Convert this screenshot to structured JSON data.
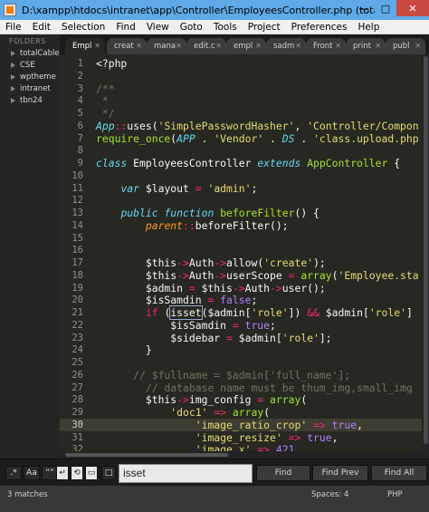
{
  "window": {
    "title": "D:\\xampp\\htdocs\\intranet\\app\\Controller\\EmployeesController.php (totalCable, C...",
    "controls": {
      "minimize": "—",
      "maximize": "□",
      "close": "✕"
    }
  },
  "menu": [
    "File",
    "Edit",
    "Selection",
    "Find",
    "View",
    "Goto",
    "Tools",
    "Project",
    "Preferences",
    "Help"
  ],
  "sidebar": {
    "header": "FOLDERS",
    "folders": [
      "totalCable",
      "CSE",
      "wptheme",
      "intranet",
      "tbn24"
    ]
  },
  "tabs": [
    {
      "label": "Empl",
      "active": true
    },
    {
      "label": "creat",
      "active": false
    },
    {
      "label": "mana",
      "active": false
    },
    {
      "label": "edit.c",
      "active": false
    },
    {
      "label": "empl",
      "active": false
    },
    {
      "label": "sadm",
      "active": false
    },
    {
      "label": "Front",
      "active": false
    },
    {
      "label": "print",
      "active": false
    },
    {
      "label": "publ",
      "active": false
    }
  ],
  "editor": {
    "current_line": 30,
    "line_numbers": [
      1,
      2,
      3,
      4,
      5,
      6,
      7,
      8,
      9,
      10,
      11,
      12,
      13,
      14,
      15,
      16,
      17,
      18,
      19,
      20,
      21,
      22,
      23,
      24,
      25,
      26,
      27,
      28,
      29,
      30,
      31,
      32
    ],
    "lines": [
      [
        [
          "wh",
          "<?php"
        ]
      ],
      [],
      [
        [
          "cm",
          "/**"
        ]
      ],
      [
        [
          "cm",
          " *"
        ]
      ],
      [
        [
          "cm",
          " */"
        ]
      ],
      [
        [
          "it",
          "App"
        ],
        [
          "kw",
          "::"
        ],
        [
          "wh",
          "uses("
        ],
        [
          "st",
          "'SimplePasswordHasher'"
        ],
        [
          "wh",
          ", "
        ],
        [
          "st",
          "'Controller/Compon"
        ]
      ],
      [
        [
          "fn",
          "require_once"
        ],
        [
          "wh",
          "("
        ],
        [
          "it",
          "APP"
        ],
        [
          "wh",
          " . "
        ],
        [
          "st",
          "'Vendor'"
        ],
        [
          "wh",
          " . "
        ],
        [
          "it",
          "DS"
        ],
        [
          "wh",
          " . "
        ],
        [
          "st",
          "'class.upload.php"
        ]
      ],
      [],
      [
        [
          "it",
          "class"
        ],
        [
          "wh",
          " EmployeesController "
        ],
        [
          "it",
          "extends"
        ],
        [
          "wh",
          " "
        ],
        [
          "fn",
          "AppController"
        ],
        [
          "wh",
          " {"
        ]
      ],
      [],
      [
        [
          "wh",
          "    "
        ],
        [
          "it",
          "var"
        ],
        [
          "wh",
          " $layout "
        ],
        [
          "kw",
          "="
        ],
        [
          "wh",
          " "
        ],
        [
          "st",
          "'admin'"
        ],
        [
          "wh",
          ";"
        ]
      ],
      [],
      [
        [
          "wh",
          "    "
        ],
        [
          "it",
          "public"
        ],
        [
          "wh",
          " "
        ],
        [
          "it",
          "function"
        ],
        [
          "wh",
          " "
        ],
        [
          "fn",
          "beforeFilter"
        ],
        [
          "wh",
          "() {"
        ]
      ],
      [
        [
          "wh",
          "        "
        ],
        [
          "va",
          "parent"
        ],
        [
          "kw",
          "::"
        ],
        [
          "wh",
          "beforeFilter();"
        ]
      ],
      [],
      [],
      [
        [
          "wh",
          "        $this"
        ],
        [
          "kw",
          "->"
        ],
        [
          "wh",
          "Auth"
        ],
        [
          "kw",
          "->"
        ],
        [
          "wh",
          "allow("
        ],
        [
          "st",
          "'create'"
        ],
        [
          "wh",
          ");"
        ]
      ],
      [
        [
          "wh",
          "        $this"
        ],
        [
          "kw",
          "->"
        ],
        [
          "wh",
          "Auth"
        ],
        [
          "kw",
          "->"
        ],
        [
          "wh",
          "userScope "
        ],
        [
          "kw",
          "="
        ],
        [
          "wh",
          " "
        ],
        [
          "fn",
          "array"
        ],
        [
          "wh",
          "("
        ],
        [
          "st",
          "'Employee.sta"
        ]
      ],
      [
        [
          "wh",
          "        $admin "
        ],
        [
          "kw",
          "="
        ],
        [
          "wh",
          " $this"
        ],
        [
          "kw",
          "->"
        ],
        [
          "wh",
          "Auth"
        ],
        [
          "kw",
          "->"
        ],
        [
          "wh",
          "user();"
        ]
      ],
      [
        [
          "wh",
          "        $isSamdin "
        ],
        [
          "kw",
          "="
        ],
        [
          "wh",
          " "
        ],
        [
          "num",
          "false"
        ],
        [
          "wh",
          ";"
        ]
      ],
      [
        [
          "wh",
          "        "
        ],
        [
          "kw",
          "if"
        ],
        [
          "wh",
          " ("
        ],
        [
          "hl",
          "isset"
        ],
        [
          "wh",
          "($admin["
        ],
        [
          "st",
          "'role'"
        ],
        [
          "wh",
          "]) "
        ],
        [
          "kw",
          "&&"
        ],
        [
          "wh",
          " $admin["
        ],
        [
          "st",
          "'role'"
        ],
        [
          "wh",
          "]"
        ]
      ],
      [
        [
          "wh",
          "            $isSamdin "
        ],
        [
          "kw",
          "="
        ],
        [
          "wh",
          " "
        ],
        [
          "num",
          "true"
        ],
        [
          "wh",
          ";"
        ]
      ],
      [
        [
          "wh",
          "            $sidebar "
        ],
        [
          "kw",
          "="
        ],
        [
          "wh",
          " $admin["
        ],
        [
          "st",
          "'role'"
        ],
        [
          "wh",
          "];"
        ]
      ],
      [
        [
          "wh",
          "        }"
        ]
      ],
      [],
      [
        [
          "wh",
          "      "
        ],
        [
          "cm",
          "// $fullname = $admin['full_name'];"
        ]
      ],
      [
        [
          "wh",
          "        "
        ],
        [
          "cm",
          "// database name must be thum_img,small_img"
        ]
      ],
      [
        [
          "wh",
          "        $this"
        ],
        [
          "kw",
          "->"
        ],
        [
          "wh",
          "img_config "
        ],
        [
          "kw",
          "="
        ],
        [
          "wh",
          " "
        ],
        [
          "fn",
          "array"
        ],
        [
          "wh",
          "("
        ]
      ],
      [
        [
          "wh",
          "            "
        ],
        [
          "st",
          "'doc1'"
        ],
        [
          "wh",
          " "
        ],
        [
          "kw",
          "=>"
        ],
        [
          "wh",
          " "
        ],
        [
          "fn",
          "array"
        ],
        [
          "wh",
          "("
        ]
      ],
      [
        [
          "wh",
          "                "
        ],
        [
          "st",
          "'image_ratio_crop'"
        ],
        [
          "wh",
          " "
        ],
        [
          "kw",
          "=>"
        ],
        [
          "wh",
          " "
        ],
        [
          "num",
          "true"
        ],
        [
          "wh",
          ","
        ]
      ],
      [
        [
          "wh",
          "                "
        ],
        [
          "st",
          "'image_resize'"
        ],
        [
          "wh",
          " "
        ],
        [
          "kw",
          "=>"
        ],
        [
          "wh",
          " "
        ],
        [
          "num",
          "true"
        ],
        [
          "wh",
          ","
        ]
      ],
      [
        [
          "wh",
          "                "
        ],
        [
          "st",
          "'image_x'"
        ],
        [
          "wh",
          " "
        ],
        [
          "kw",
          "=>"
        ],
        [
          "wh",
          " "
        ],
        [
          "num",
          "421"
        ]
      ]
    ]
  },
  "find": {
    "options": [
      "regex",
      "case-sensitive",
      "whole-word",
      "wrap",
      "in-selection",
      "highlight"
    ],
    "option_labels": {
      "regex": ".*",
      "case": "Aa",
      "word": "“”"
    },
    "query": "isset",
    "buttons": {
      "find": "Find",
      "find_prev": "Find Prev",
      "find_all": "Find All"
    }
  },
  "status": {
    "matches": "3 matches",
    "spaces": "Spaces: 4",
    "syntax": "PHP"
  }
}
